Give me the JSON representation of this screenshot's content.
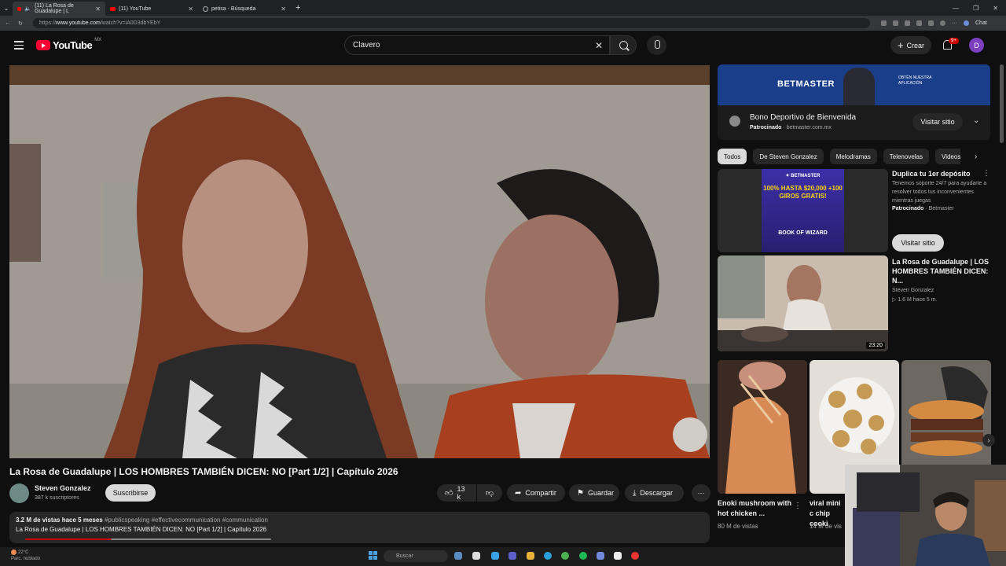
{
  "browser": {
    "tabs": [
      {
        "label": "(11) La Rosa de Guadalupe | L",
        "active": true
      },
      {
        "label": "(11) YouTube",
        "active": false
      },
      {
        "label": "petisa - Búsqueda",
        "active": false
      }
    ],
    "url_prefix": "https://",
    "url_host": "www.youtube.com",
    "url_path": "/watch?v=iA0D3dbYEbY",
    "chat_label": "Chat"
  },
  "header": {
    "logo_text": "YouTube",
    "country": "MX",
    "search_value": "Clavero",
    "create_label": "Crear",
    "notif_badge": "9+",
    "avatar_letter": "D"
  },
  "video": {
    "title": "La Rosa de Guadalupe | LOS HOMBRES TAMBIÉN DICEN: NO [Part 1/2] | Capítulo 2026",
    "channel": "Steven Gonzalez",
    "subscribers": "387 k suscriptores",
    "subscribe_label": "Suscribirse",
    "likes": "13 k",
    "share_label": "Compartir",
    "save_label": "Guardar",
    "download_label": "Descargar",
    "views_age": "3.2 M de vistas  hace 5 meses",
    "hashtags": "#publicspeaking #effectivecommunication #communication",
    "desc_line": "La Rosa de Guadalupe | LOS HOMBRES TAMBIÉN DICEN: NO [Part 1/2] | Capítulo 2026",
    "progress": 0.35
  },
  "sidebar": {
    "banner_ad": {
      "brand": "BETMASTER",
      "tagline": "OBTÉN NUESTRA APLICACIÓN"
    },
    "ad_info": {
      "title": "Bono Deportivo de Bienvenida",
      "sponsored": "Patrocinado",
      "domain": "· betmaster.com.mx",
      "visit_label": "Visitar sitio"
    },
    "chips": [
      "Todos",
      "De Steven Gonzalez",
      "Melodramas",
      "Telenovelas",
      "Videos"
    ],
    "ad_card": {
      "img_brand": "✦ BETMASTER",
      "img_offer": "100% HASTA $20,000 +100 GIROS GRATIS!",
      "img_game": "BOOK OF WIZARD",
      "title": "Duplica tu 1er depósito",
      "text": "Tenemos soporte 24/7 para ayudarte a resolver todos tus inconvenientes mientras juegas",
      "sponsored": "Patrocinado",
      "advertiser": "· Betmaster",
      "visit_label": "Visitar sitio"
    },
    "recommended": {
      "title": "La Rosa de Guadalupe | LOS HOMBRES TAMBIÉN DICEN: N...",
      "channel": "Steven Gonzalez",
      "stats": "▷ 1.6 M  hace 5 m.",
      "duration": "23:20"
    },
    "shorts": [
      {
        "title": "Enoki mushroom with hot chicken ...",
        "views": "80 M de vistas"
      },
      {
        "title": "viral mini c chip cooki",
        "views": "14 M de vis"
      },
      {
        "title": "",
        "views": ""
      }
    ]
  },
  "taskbar": {
    "temp": "22°C",
    "weather": "Parc. nublado",
    "search_placeholder": "Buscar"
  }
}
